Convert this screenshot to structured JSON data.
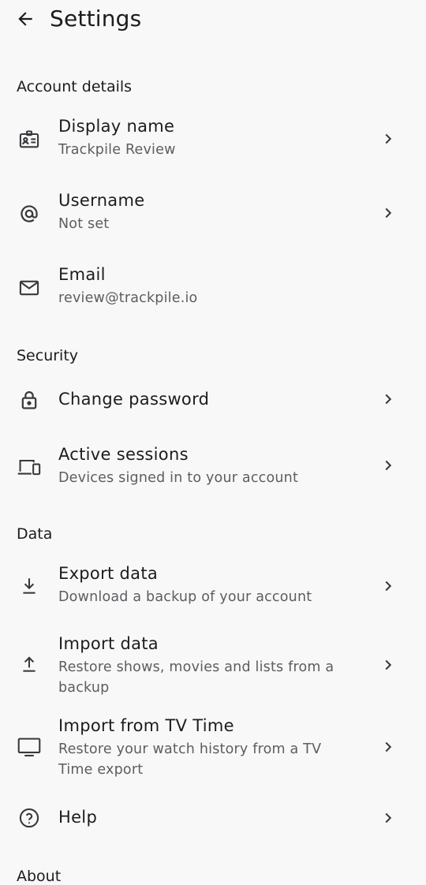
{
  "appbar": {
    "title": "Settings",
    "back_icon": "arrow-left-icon"
  },
  "sections": {
    "account": {
      "header": "Account details",
      "display_name": {
        "title": "Display name",
        "subtitle": "Trackpile Review",
        "icon": "id-badge-icon"
      },
      "username": {
        "title": "Username",
        "subtitle": "Not set",
        "icon": "at-sign-icon"
      },
      "email": {
        "title": "Email",
        "subtitle": "review@trackpile.io",
        "icon": "mail-icon"
      }
    },
    "security": {
      "header": "Security",
      "change_password": {
        "title": "Change password",
        "icon": "lock-icon"
      },
      "active_sessions": {
        "title": "Active sessions",
        "subtitle": "Devices signed in to your account",
        "icon": "devices-icon"
      }
    },
    "data": {
      "header": "Data",
      "export": {
        "title": "Export data",
        "subtitle": "Download a backup of your account",
        "icon": "download-icon"
      },
      "import": {
        "title": "Import data",
        "subtitle": "Restore shows, movies and lists from a backup",
        "icon": "upload-icon"
      },
      "import_tvtime": {
        "title": "Import from TV Time",
        "subtitle": "Restore your watch history from a TV Time export",
        "icon": "tv-icon"
      },
      "help": {
        "title": "Help",
        "icon": "help-circle-icon"
      }
    },
    "about": {
      "header": "About"
    }
  },
  "colors": {
    "background": "#f8f8f8",
    "text": "#1d1b1e",
    "secondary_text": "#5f5c61",
    "icon": "#3a383c"
  }
}
